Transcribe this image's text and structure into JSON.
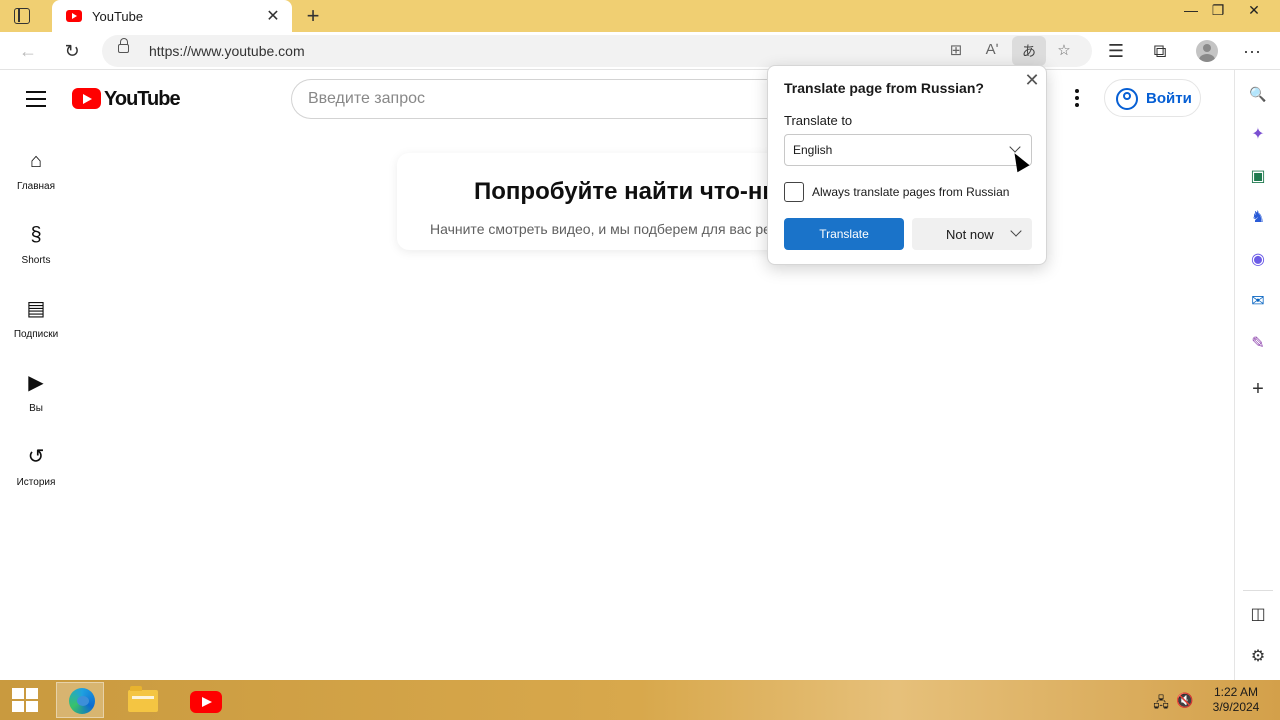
{
  "browser": {
    "tab": {
      "title": "YouTube",
      "close": "✕"
    },
    "new_tab": "+",
    "window_controls": {
      "minimize": "—",
      "maximize": "❐",
      "close": "✕"
    },
    "nav": {
      "back": "←",
      "refresh": "↻"
    },
    "address": {
      "url": "https://www.youtube.com"
    },
    "toolbar_icons": [
      "split-screen-icon",
      "read-aloud-icon",
      "translate-icon",
      "add-favorite-icon",
      "favorites-icon",
      "collections-icon",
      "profile-icon",
      "more-icon"
    ],
    "glyphs": {
      "split": "⊞",
      "read_aloud": "Aʹ",
      "translate": "あ",
      "add_fav": "☆",
      "favorites": "☰",
      "collections": "⧉",
      "more": "···"
    }
  },
  "translate_popup": {
    "title": "Translate page from Russian?",
    "close": "✕",
    "translate_to_label": "Translate to",
    "selected_language": "English",
    "always_translate_label": "Always translate pages from Russian",
    "always_translate_checked": false,
    "translate_button": "Translate",
    "not_now_button": "Not now"
  },
  "youtube": {
    "logo_text": "YouTube",
    "search_placeholder": "Введите запрос",
    "sign_in": "Войти",
    "guide": [
      {
        "label": "Главная",
        "icon": "home-icon",
        "glyph": "⌂"
      },
      {
        "label": "Shorts",
        "icon": "shorts-icon",
        "glyph": "§"
      },
      {
        "label": "Подписки",
        "icon": "subscriptions-icon",
        "glyph": "▤"
      },
      {
        "label": "Вы",
        "icon": "you-icon",
        "glyph": "▶"
      },
      {
        "label": "История",
        "icon": "history-icon",
        "glyph": "↺"
      }
    ],
    "empty_state": {
      "title": "Попробуйте найти что-нибудь",
      "subtitle": "Начните смотреть видео, и мы подберем для вас рекомендации."
    }
  },
  "edge_sidebar": {
    "icons": [
      "search-icon",
      "copilot-icon",
      "shopping-icon",
      "games-icon",
      "microsoft365-icon",
      "outlook-icon",
      "designer-icon",
      "add-icon",
      "split-pane-icon",
      "settings-icon"
    ],
    "glyphs": {
      "search": "🔍",
      "copilot": "✦",
      "shopping": "▣",
      "games": "♞",
      "m365": "◉",
      "outlook": "✉",
      "designer": "✎",
      "add": "+",
      "split": "◫",
      "settings": "⚙"
    }
  },
  "taskbar": {
    "apps": [
      "edge",
      "file-explorer",
      "youtube"
    ],
    "tray": {
      "network": "🖧",
      "volume": "🔇"
    },
    "time": "1:22 AM",
    "date": "3/9/2024"
  },
  "colors": {
    "title_bar": "#f0cf72",
    "youtube_red": "#ff0000",
    "translate_button": "#1a73c9",
    "signin_blue": "#065fd4"
  }
}
